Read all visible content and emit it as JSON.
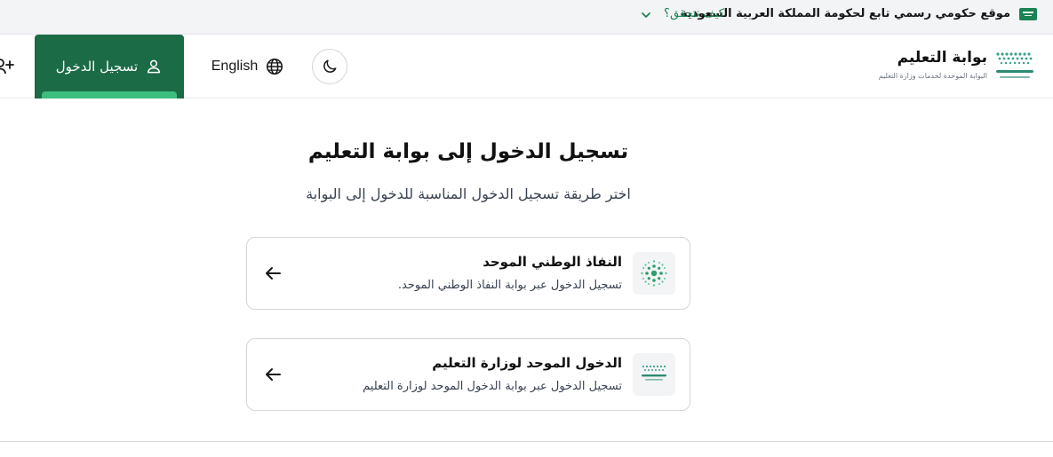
{
  "gov_banner": {
    "text": "موقع حكومي رسمي تابع لحكومة المملكة العربية السعودية",
    "check_link": "كيف تتحقق؟"
  },
  "header": {
    "logo_title": "بوابة التعليم",
    "logo_subtitle": "البوابة الموحدة لخدمات وزارة التعليم",
    "language_label": "English",
    "login_label": "تسجيل الدخول"
  },
  "main": {
    "title": "تسجيل الدخول إلى بوابة التعليم",
    "subtitle": "اختر طريقة تسجيل الدخول المناسبة للدخول إلى البوابة",
    "options": [
      {
        "title": "النفاذ الوطني الموحد",
        "description": "تسجيل الدخول عبر بوابة النفاذ الوطني الموحد.",
        "icon": "nafath-icon"
      },
      {
        "title": "الدخول الموحد لوزارة التعليم",
        "description": "تسجيل الدخول عبر بوابة الدخول الموحد لوزارة التعليم",
        "icon": "moe-logo-icon"
      }
    ]
  },
  "colors": {
    "brand_green": "#1b6b47",
    "accent_green": "#3dbd7e",
    "link_green": "#1b8354"
  }
}
